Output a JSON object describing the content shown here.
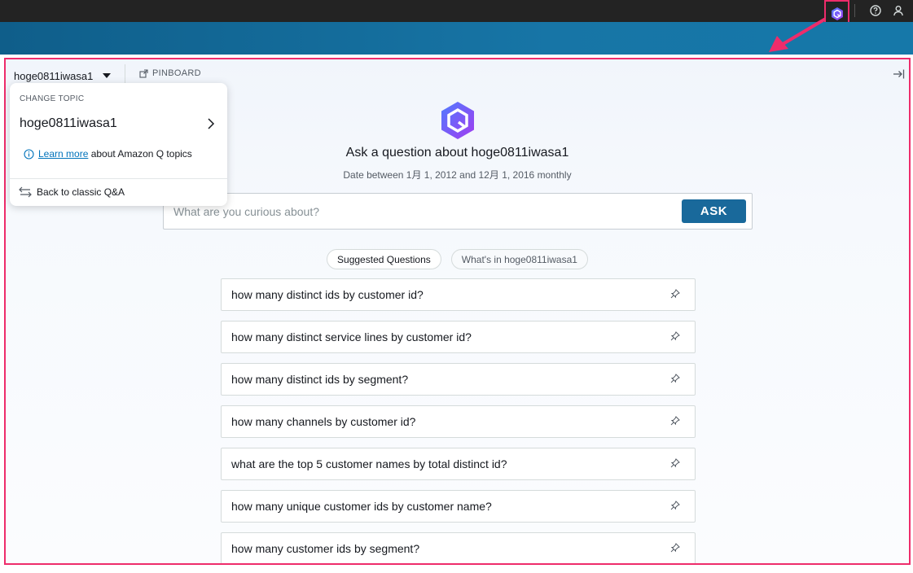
{
  "panel": {
    "topic_name": "hoge0811iwasa1",
    "pinboard_label": "PINBOARD",
    "title": "Ask a question about hoge0811iwasa1",
    "subtitle": "Date between 1月 1, 2012 and 12月 1, 2016 monthly",
    "ask_placeholder": "What are you curious about?",
    "ask_label": "ASK",
    "pills": {
      "suggested": "Suggested Questions",
      "whats_in": "What's in hoge0811iwasa1"
    },
    "questions": [
      "how many distinct ids by customer id?",
      "how many distinct service lines by customer id?",
      "how many distinct ids by segment?",
      "how many channels by customer id?",
      "what are the top 5 customer names by total distinct id?",
      "how many unique customer ids by customer name?",
      "how many customer ids by segment?"
    ]
  },
  "dropdown": {
    "header": "CHANGE TOPIC",
    "current_topic": "hoge0811iwasa1",
    "learn_more_link": "Learn more",
    "learn_more_text": " about Amazon Q topics",
    "back_label": "Back to classic Q&A"
  },
  "colors": {
    "accent_pink": "#ee2c6b",
    "ask_button": "#19699b",
    "link": "#0073bb"
  }
}
